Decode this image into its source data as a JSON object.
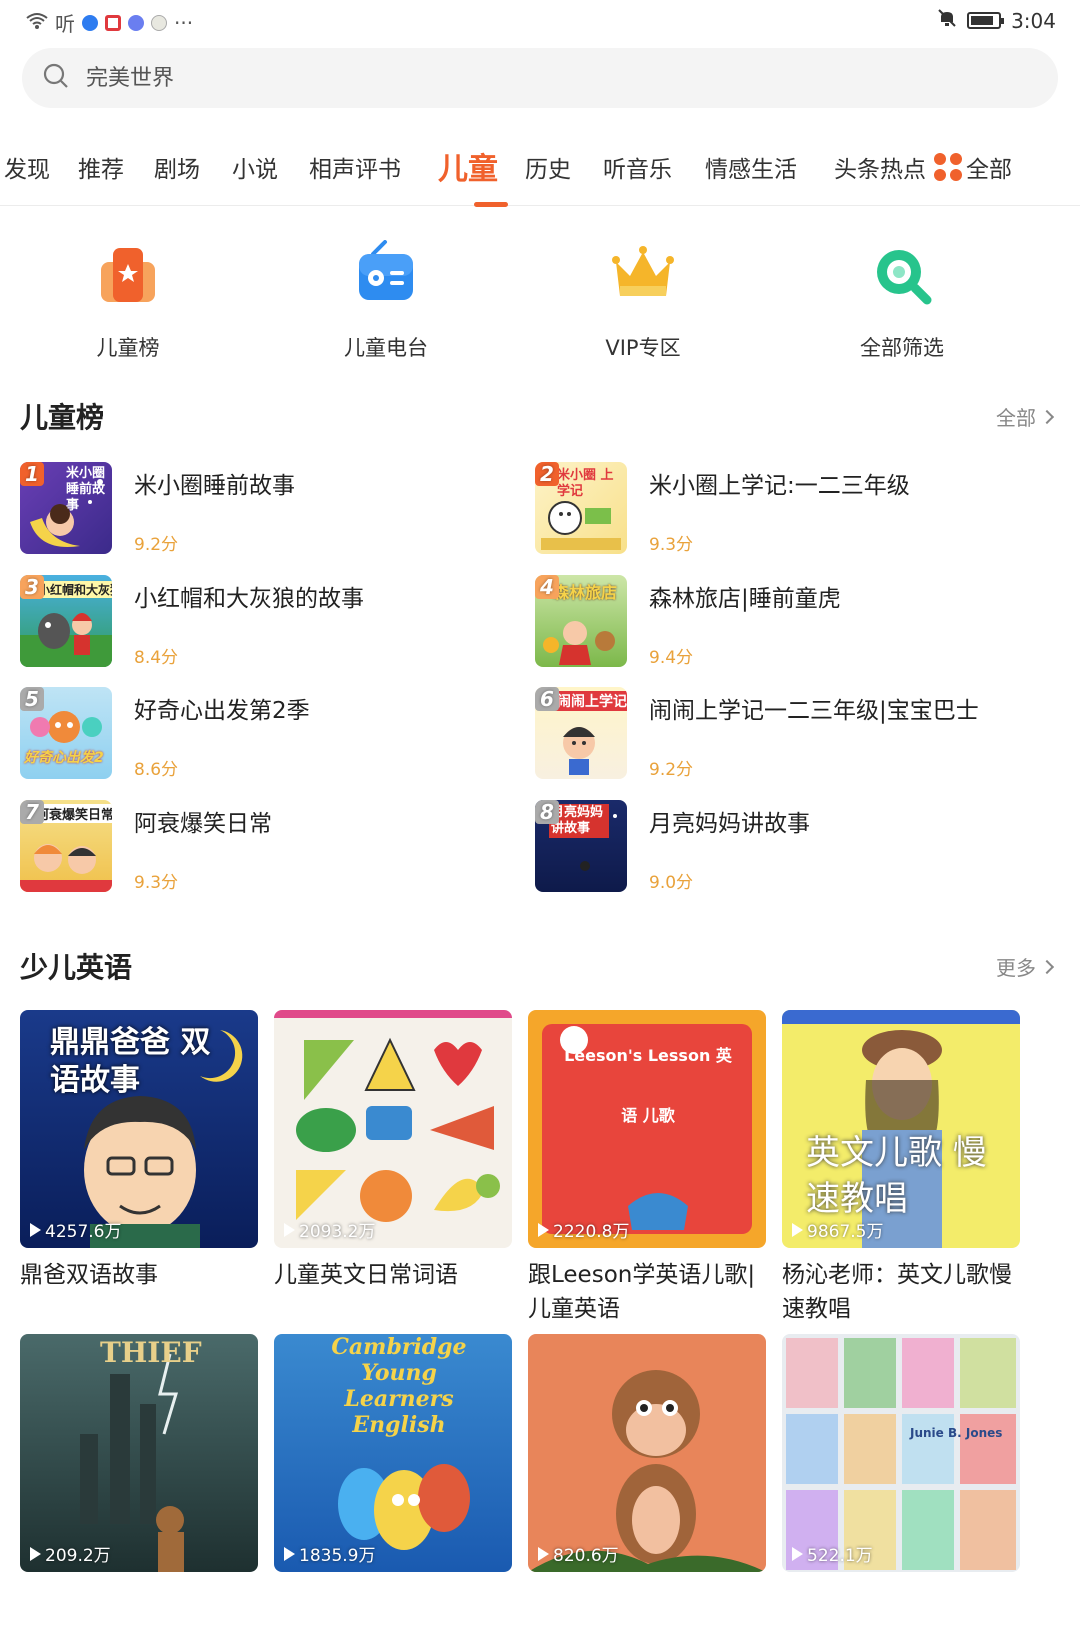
{
  "status_bar": {
    "left_text": "听",
    "more": "···",
    "time": "3:04"
  },
  "search": {
    "placeholder": "完美世界",
    "icon": "search-icon"
  },
  "tabs": [
    {
      "label": "发现"
    },
    {
      "label": "推荐"
    },
    {
      "label": "剧场"
    },
    {
      "label": "小说"
    },
    {
      "label": "相声评书"
    },
    {
      "label": "儿童",
      "active": true
    },
    {
      "label": "历史"
    },
    {
      "label": "听音乐"
    },
    {
      "label": "情感生活"
    },
    {
      "label": "头条热点"
    }
  ],
  "all_tab": {
    "label": "全部",
    "icon": "category-grid-icon"
  },
  "quick_entries": [
    {
      "label": "儿童榜",
      "icon": "chart-icon",
      "color": "#f0612c"
    },
    {
      "label": "儿童电台",
      "icon": "radio-icon",
      "color": "#2e8cf0"
    },
    {
      "label": "VIP专区",
      "icon": "crown-icon",
      "color": "#f5b52a"
    },
    {
      "label": "全部筛选",
      "icon": "search-filter-icon",
      "color": "#27c48c"
    }
  ],
  "ranking": {
    "title": "儿童榜",
    "more": "全部",
    "items": [
      {
        "rank": "1",
        "title": "米小圈睡前故事",
        "score": "9.2分",
        "cover_text": "米小圈 睡前故事"
      },
      {
        "rank": "2",
        "title": "米小圈上学记:一二三年级",
        "score": "9.3分",
        "cover_text": "米小圈 上学记"
      },
      {
        "rank": "3",
        "title": "小红帽和大灰狼的故事",
        "score": "8.4分",
        "cover_text": "小红帽和大灰狼"
      },
      {
        "rank": "4",
        "title": "森林旅店|睡前童虎",
        "score": "9.4分",
        "cover_text": "森林旅店"
      },
      {
        "rank": "5",
        "title": "好奇心出发第2季",
        "score": "8.6分",
        "cover_text": "好奇心出发2"
      },
      {
        "rank": "6",
        "title": "闹闹上学记一二三年级|宝宝巴士",
        "score": "9.2分",
        "cover_text": "闹闹上学记"
      },
      {
        "rank": "7",
        "title": "阿衰爆笑日常",
        "score": "9.3分",
        "cover_text": "阿衰爆笑日常"
      },
      {
        "rank": "8",
        "title": "月亮妈妈讲故事",
        "score": "9.0分",
        "cover_text": "月亮妈妈讲故事"
      }
    ]
  },
  "english": {
    "title": "少儿英语",
    "more": "更多",
    "cards": [
      {
        "title": "鼎爸双语故事",
        "plays": "4257.6万",
        "cover_text": "鼎鼎爸爸 双语故事"
      },
      {
        "title": "儿童英文日常词语",
        "plays": "2093.2万",
        "cover_text": ""
      },
      {
        "title": "跟Leeson学英语儿歌|儿童英语",
        "plays": "2220.8万",
        "cover_text": "Leeson's Lesson 英语 儿歌"
      },
      {
        "title": "杨沁老师：英文儿歌慢速教唱",
        "plays": "9867.5万",
        "cover_text": "英文儿歌 慢速教唱"
      },
      {
        "title": "",
        "plays": "209.2万",
        "cover_text": "THIEF"
      },
      {
        "title": "",
        "plays": "1835.9万",
        "cover_text": "Cambridge Young Learners English"
      },
      {
        "title": "",
        "plays": "820.6万",
        "cover_text": ""
      },
      {
        "title": "",
        "plays": "522.1万",
        "cover_text": "Junie B. Jones"
      }
    ]
  }
}
